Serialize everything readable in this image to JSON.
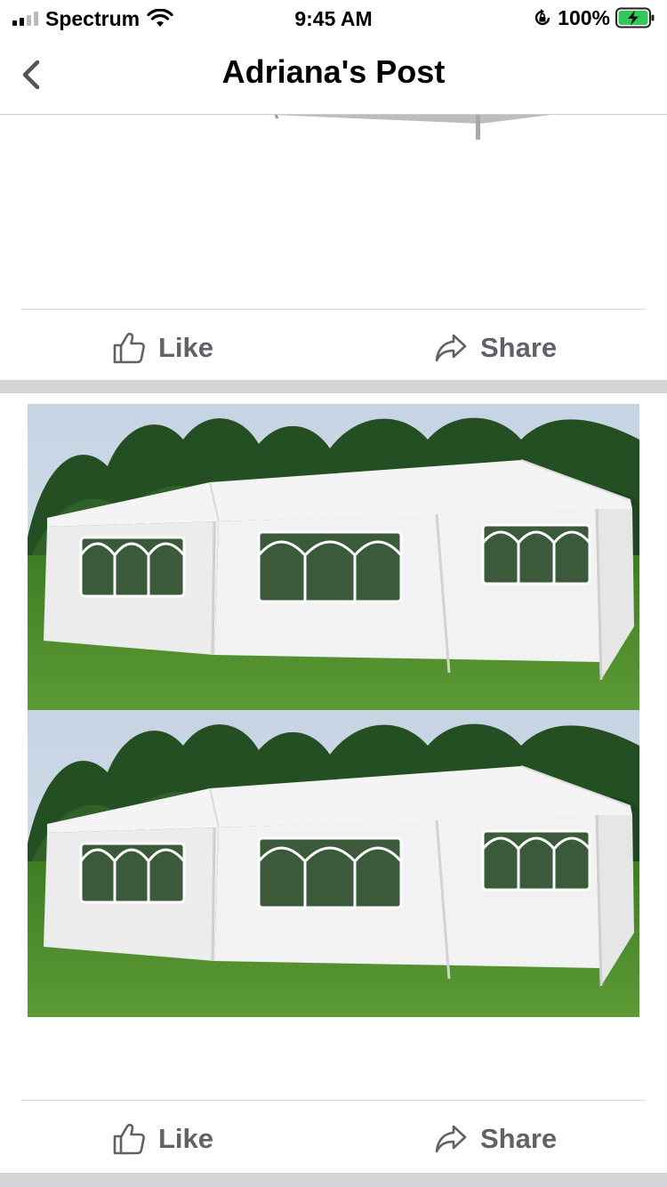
{
  "status_bar": {
    "carrier": "Spectrum",
    "time": "9:45 AM",
    "battery_percent": "100%"
  },
  "nav": {
    "title": "Adriana's Post",
    "back_icon": "chevron-left-icon"
  },
  "posts": [
    {
      "like_label": "Like",
      "share_label": "Share"
    },
    {
      "like_label": "Like",
      "share_label": "Share"
    }
  ],
  "colors": {
    "action_text": "#5f6368",
    "separator": "#d3d4d8",
    "grass": "#4d8a2f",
    "trees": "#1f4a22",
    "sky": "#c9d6e4",
    "battery_green": "#34c759"
  }
}
